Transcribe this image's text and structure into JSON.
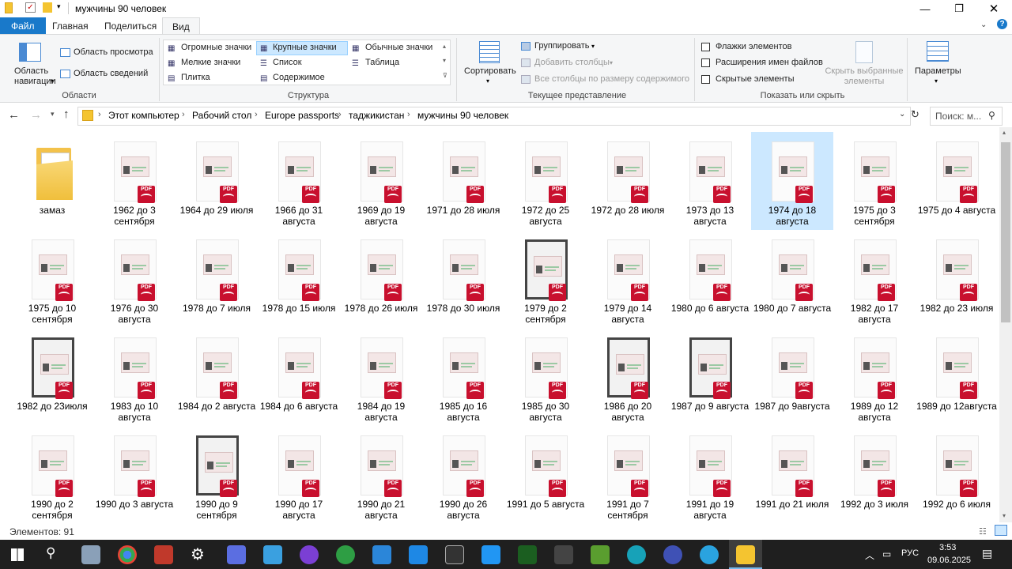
{
  "window": {
    "title": "мужчины 90 человек",
    "controls": [
      "minimize",
      "restore",
      "close"
    ]
  },
  "ribbon_tabs": [
    {
      "label": "Файл"
    },
    {
      "label": "Главная"
    },
    {
      "label": "Поделиться"
    },
    {
      "label": "Вид"
    }
  ],
  "ribbon": {
    "areas": {
      "nav_pane_label": "Область навигации",
      "preview_pane": "Область просмотра",
      "details_pane": "Область сведений",
      "group": "Области"
    },
    "layout": {
      "items": [
        "Огромные значки",
        "Крупные значки",
        "Обычные значки",
        "Мелкие значки",
        "Список",
        "Таблица",
        "Плитка",
        "Содержимое"
      ],
      "selected": "Крупные значки",
      "group": "Структура"
    },
    "current_view": {
      "sort": "Сортировать",
      "group_by": "Группировать",
      "add_columns": "Добавить столбцы",
      "size_all_columns": "Все столбцы по размеру содержимого",
      "group": "Текущее представление"
    },
    "show_hide": {
      "checkboxes": [
        "Флажки элементов",
        "Расширения имен файлов",
        "Скрытые элементы"
      ],
      "hide_selected": "Скрыть выбранные элементы",
      "group": "Показать или скрыть"
    },
    "options": "Параметры"
  },
  "address": {
    "path": [
      "Этот компьютер",
      "Рабочий стол",
      "Europe passports",
      "таджикистан",
      "мужчины 90 человек"
    ],
    "search_placeholder": "Поиск: м..."
  },
  "items": [
    {
      "label": "замаз",
      "type": "folder"
    },
    {
      "label": "1962 до 3 сентября",
      "type": "pdf"
    },
    {
      "label": "1964 до 29 июля",
      "type": "pdf"
    },
    {
      "label": "1966 до 31 августа",
      "type": "pdf"
    },
    {
      "label": "1969 до 19 августа",
      "type": "pdf"
    },
    {
      "label": "1971 до 28 июля",
      "type": "pdf"
    },
    {
      "label": "1972 до 25 августа",
      "type": "pdf"
    },
    {
      "label": "1972 до 28 июля",
      "type": "pdf"
    },
    {
      "label": "1973 до 13 августа",
      "type": "pdf"
    },
    {
      "label": "1974 до 18 августа",
      "type": "pdf",
      "selected": true
    },
    {
      "label": "1975 до 3 сентября",
      "type": "pdf"
    },
    {
      "label": "1975 до 4 августа",
      "type": "pdf"
    },
    {
      "label": "1975 до 10 сентября",
      "type": "pdf"
    },
    {
      "label": "1976 до 30 августа",
      "type": "pdf"
    },
    {
      "label": "1978 до 7 июля",
      "type": "pdf"
    },
    {
      "label": "1978 до 15 июля",
      "type": "pdf"
    },
    {
      "label": "1978 до 26 июля",
      "type": "pdf"
    },
    {
      "label": "1978 до 30 июля",
      "type": "pdf"
    },
    {
      "label": "1979 до 2 сентября",
      "type": "pdf",
      "dark": true
    },
    {
      "label": "1979 до 14 августа",
      "type": "pdf"
    },
    {
      "label": "1980 до 6 августа",
      "type": "pdf"
    },
    {
      "label": "1980 до 7 августа",
      "type": "pdf"
    },
    {
      "label": "1982 до 17 августа",
      "type": "pdf"
    },
    {
      "label": "1982 до 23 июля",
      "type": "pdf"
    },
    {
      "label": "1982 до 23июля",
      "type": "pdf",
      "dark": true
    },
    {
      "label": "1983 до 10 августа",
      "type": "pdf"
    },
    {
      "label": "1984 до 2 августа",
      "type": "pdf"
    },
    {
      "label": "1984 до 6 августа",
      "type": "pdf"
    },
    {
      "label": "1984 до 19 августа",
      "type": "pdf"
    },
    {
      "label": "1985 до 16 августа",
      "type": "pdf"
    },
    {
      "label": "1985 до 30 августа",
      "type": "pdf"
    },
    {
      "label": "1986 до 20 августа",
      "type": "pdf",
      "dark": true
    },
    {
      "label": "1987 до 9 августа",
      "type": "pdf",
      "dark": true
    },
    {
      "label": "1987 до 9августа",
      "type": "pdf"
    },
    {
      "label": "1989 до 12 августа",
      "type": "pdf"
    },
    {
      "label": "1989 до 12августа",
      "type": "pdf"
    },
    {
      "label": "1990 до 2 сентября",
      "type": "pdf"
    },
    {
      "label": "1990 до 3 августа",
      "type": "pdf"
    },
    {
      "label": "1990 до 9 сентября",
      "type": "pdf",
      "dark": true
    },
    {
      "label": "1990 до 17 августа",
      "type": "pdf"
    },
    {
      "label": "1990 до 21 августа",
      "type": "pdf"
    },
    {
      "label": "1990 до 26 августа",
      "type": "pdf"
    },
    {
      "label": "1991 до 5 августа",
      "type": "pdf"
    },
    {
      "label": "1991 до 7 сентября",
      "type": "pdf"
    },
    {
      "label": "1991 до 19 августа",
      "type": "pdf"
    },
    {
      "label": "1991 до 21 июля",
      "type": "pdf"
    },
    {
      "label": "1992 до 3 июля",
      "type": "pdf"
    },
    {
      "label": "1992 до 6 июля",
      "type": "pdf"
    }
  ],
  "pdf_badge": "PDF",
  "status": {
    "count_text": "Элементов: 91"
  },
  "taskbar": {
    "lang": "РУС",
    "time": "3:53",
    "date": "09.06.2025"
  },
  "colors": {
    "accent": "#1979ca",
    "selection": "#cce8ff",
    "pdf": "#c8102e",
    "taskbar": "#1f1f1f"
  }
}
